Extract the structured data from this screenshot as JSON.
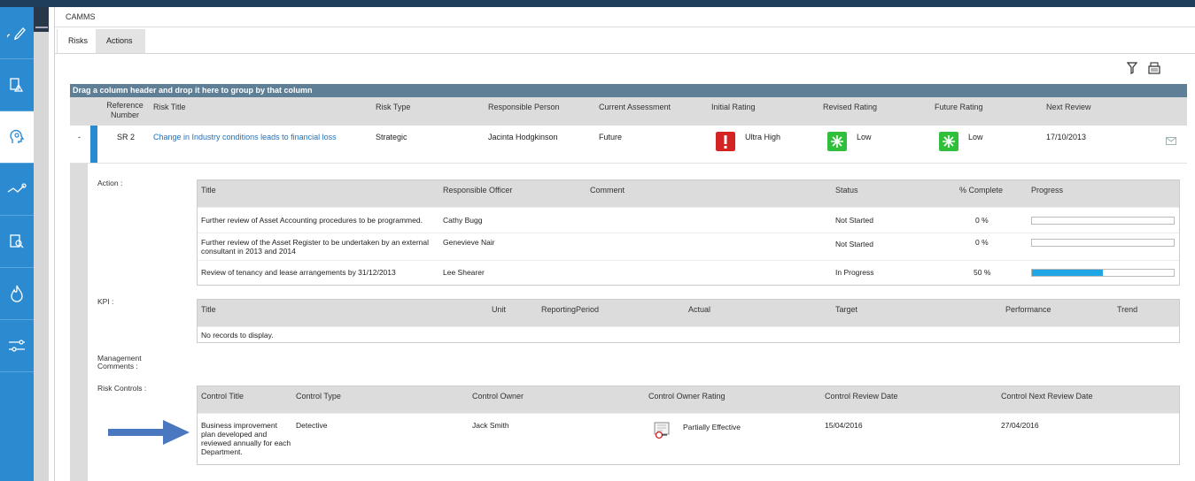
{
  "colors": {
    "sidebar": "#2b8ad0",
    "topbar": "#1f3e5c",
    "groupbar": "#5f7f96",
    "link": "#2470b8",
    "progress": "#20a6e4",
    "ultra_high": "#d32323",
    "low": "#2fbf3a"
  },
  "sidebar_icons": [
    "pencil-icon",
    "document-warning-icon",
    "risk-head-icon",
    "trend-icon",
    "document-search-icon",
    "fire-icon",
    "sliders-icon"
  ],
  "crumb": "CAMMS",
  "tabs": {
    "risks": "Risks",
    "actions": "Actions"
  },
  "toolbar": {
    "filter_icon": "filter-icon",
    "export_icon": "export-icon"
  },
  "grid": {
    "group_hint": "Drag a column header and drop it here to group by that column",
    "headers": {
      "ref_line1": "Reference",
      "ref_line2": "Number",
      "risk_title": "Risk Title",
      "risk_type": "Risk Type",
      "responsible": "Responsible Person",
      "current": "Current Assessment",
      "initial": "Initial Rating",
      "revised": "Revised Rating",
      "future": "Future Rating",
      "next_review": "Next Review"
    },
    "row": {
      "toggle": "-",
      "ref": "SR 2",
      "title": "Change in Industry conditions leads to financial loss",
      "type": "Strategic",
      "person": "Jacinta Hodgkinson",
      "current": "Future",
      "initial": "Ultra High",
      "revised": "Low",
      "future": "Low",
      "next_review": "17/10/2013",
      "mail_icon": "mail-icon"
    }
  },
  "detail": {
    "labels": {
      "action": "Action :",
      "kpi": "KPI :",
      "mgmt_line1": "Management",
      "mgmt_line2": "Comments :",
      "controls": "Risk Controls :"
    },
    "actions": {
      "headers": {
        "title": "Title",
        "officer": "Responsible Officer",
        "comment": "Comment",
        "status": "Status",
        "pct": "% Complete",
        "progress": "Progress"
      },
      "rows": [
        {
          "title_line1": "Further review of Asset Accounting procedures to be programmed.",
          "title_line2": "",
          "officer": "Cathy Bugg",
          "status": "Not Started",
          "pct": "0 %",
          "progress": 0.0
        },
        {
          "title_line1": "Further review of the Asset Register to be undertaken by an external",
          "title_line2": "consultant in 2013 and 2014",
          "officer": "Genevieve Nair",
          "status": "Not Started",
          "pct": "0 %",
          "progress": 0.0
        },
        {
          "title_line1": "Review of tenancy and lease arrangements by 31/12/2013",
          "title_line2": "",
          "officer": "Lee Shearer",
          "status": "In Progress",
          "pct": "50 %",
          "progress": 0.5
        }
      ]
    },
    "kpi": {
      "headers": {
        "title": "Title",
        "unit": "Unit",
        "period": "ReportingPeriod",
        "actual": "Actual",
        "target": "Target",
        "performance": "Performance",
        "trend": "Trend"
      },
      "empty": "No records to display."
    },
    "controls": {
      "headers": {
        "title": "Control Title",
        "type": "Control Type",
        "owner": "Control Owner",
        "rating": "Control Owner Rating",
        "review": "Control Review Date",
        "next": "Control Next Review Date"
      },
      "row": {
        "title_lines": [
          "Business improvement",
          "plan developed and",
          "reviewed annually for each",
          "Department."
        ],
        "type": "Detective",
        "owner": "Jack Smith",
        "rating": "Partially Effective",
        "review": "15/04/2016",
        "next": "27/04/2016"
      }
    }
  }
}
